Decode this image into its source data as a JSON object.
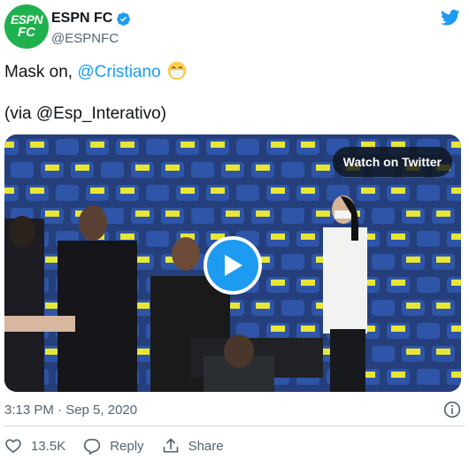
{
  "account": {
    "avatar_line1": "ESPN",
    "avatar_line2": "FC",
    "display_name": "ESPN FC",
    "handle": "@ESPNFC"
  },
  "tweet": {
    "text_prefix": "Mask on, ",
    "mention": "@Cristiano",
    "via_text": "(via @Esp_Interativo)"
  },
  "media": {
    "watch_label": "Watch on Twitter"
  },
  "meta": {
    "timestamp": "3:13 PM · Sep 5, 2020"
  },
  "actions": {
    "likes": "13.5K",
    "reply_label": "Reply",
    "share_label": "Share"
  },
  "colors": {
    "accent": "#1d9bf0",
    "avatar_bg": "#1fb14d",
    "text": "#0f1419",
    "muted": "#536471"
  },
  "icons": [
    "verified-badge-icon",
    "twitter-bird-icon",
    "mask-emoji-icon",
    "play-icon",
    "info-icon",
    "heart-icon",
    "reply-icon",
    "share-icon"
  ]
}
